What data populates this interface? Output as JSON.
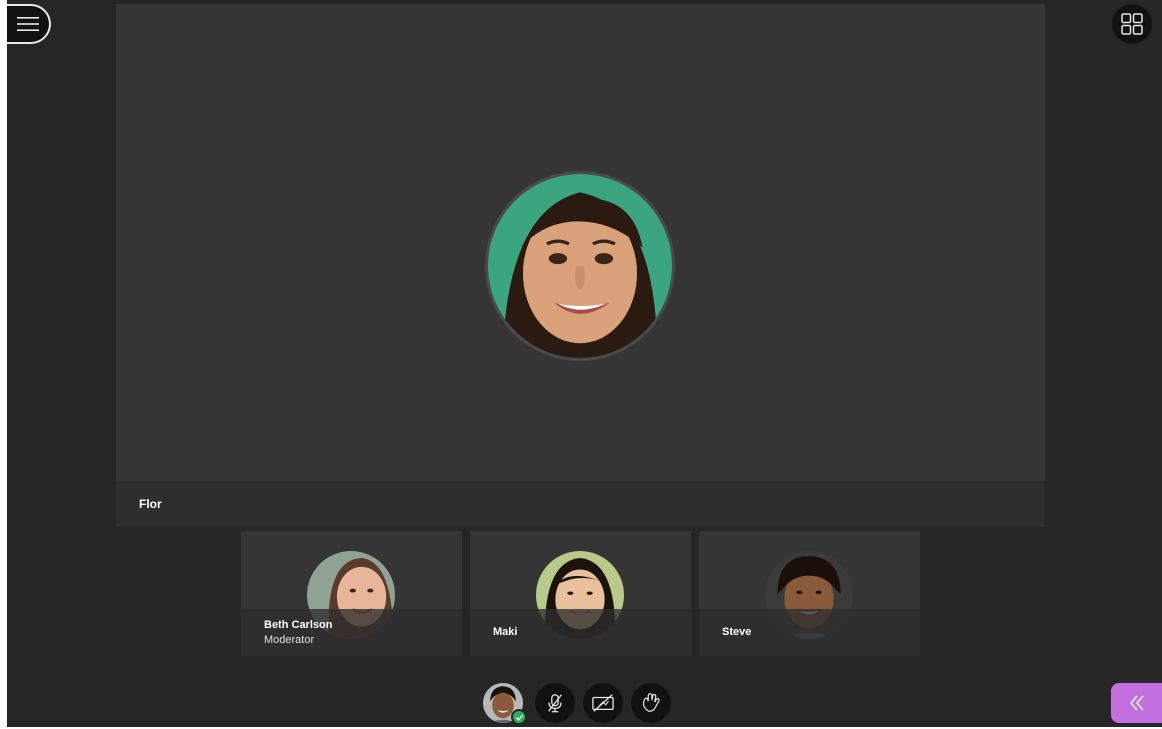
{
  "stage": {
    "speaker_name": "Flor"
  },
  "participants": [
    {
      "name": "Beth Carlson",
      "role": "Moderator"
    },
    {
      "name": "Maki",
      "role": ""
    },
    {
      "name": "Steve",
      "role": ""
    }
  ],
  "icons": {
    "menu": "menu-icon",
    "grid": "grid-view-icon",
    "mic": "microphone-off-icon",
    "camera": "camera-off-icon",
    "hand": "raise-hand-icon",
    "collapse": "chevron-double-left-icon",
    "status": "check-icon"
  },
  "colors": {
    "app_background": "#262626",
    "stage_background": "#353535",
    "accent": "#c26fe0",
    "status_ok": "#2dad5b"
  }
}
